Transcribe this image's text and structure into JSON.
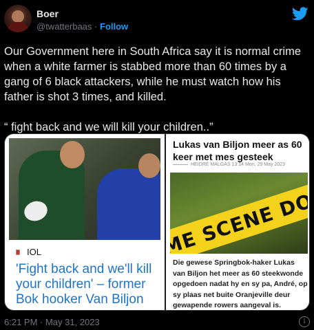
{
  "author": {
    "name": "Boer",
    "handle": "@twatterbaas",
    "separator": "·",
    "follow_label": "Follow"
  },
  "tweet": {
    "paragraphs": [
      "Our Government here in South Africa say it is normal crime when a white farmer is stabbed more than 60 times by a gang of 6 black attackers, while he must watch how his father is shot 3 times, and killed.",
      "“ fight back and we will kill your children..”"
    ]
  },
  "card_left": {
    "source": "IOL",
    "title": "'Fight back and we'll kill your children' – former Bok hooker Van Biljon"
  },
  "card_right": {
    "title": "Lukas van Biljon meer as 60 keer met mes gesteek",
    "byline": "HEIDRÉ MALGAS 13:14 Mon, 29 May 2023",
    "image_text": "CRIME SCENE DO NOT",
    "body": "Die gewese Springbok-haker Lukas van Biljon het meer as 60 steekwonde opgedoen nadat hy en sy pa, André, op sy plaas net buite Oranjeville deur gewapende rowers aangeval is."
  },
  "footer": {
    "timestamp": "6:21 PM · May 31, 2023",
    "info_icon": "i"
  },
  "colors": {
    "accent": "#1d9bf0",
    "link_blue": "#1d74c6",
    "tape_yellow": "#f4d21c"
  },
  "icons": [
    "twitter-bird-icon",
    "info-icon",
    "iol-flag-icon"
  ]
}
